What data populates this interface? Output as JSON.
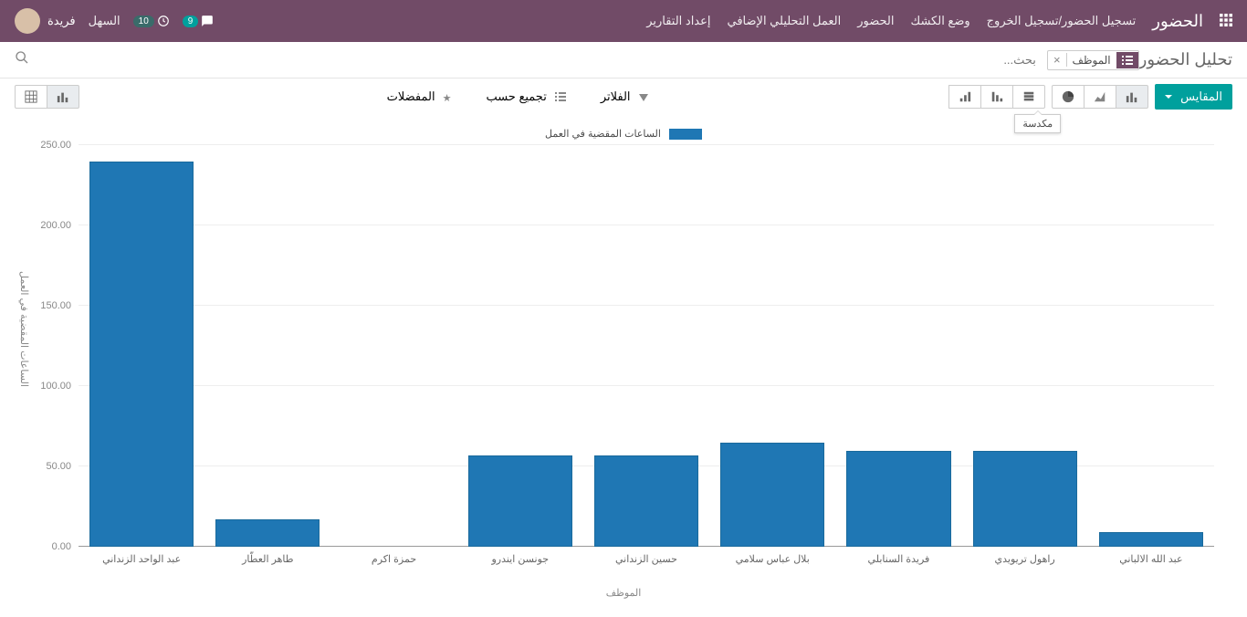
{
  "topbar": {
    "brand": "الحضور",
    "nav": [
      "تسجيل الحضور/تسجيل الخروج",
      "وضع الكشك",
      "الحضور",
      "العمل التحليلي الإضافي",
      "إعداد التقارير"
    ],
    "messages_badge": "9",
    "activities_badge": "10",
    "easy_label": "السهل",
    "user_name": "فريدة"
  },
  "control": {
    "page_title": "تحليل الحضور",
    "facet_label": "الموظف",
    "facet_remove": "×",
    "search_placeholder": "بحث..."
  },
  "toolbar": {
    "measures_label": "المقايس",
    "filters_label": "الفلاتر",
    "groupby_label": "تجميع حسب",
    "favorites_label": "المفضلات",
    "tooltip_stacked": "مكدسة"
  },
  "chart_data": {
    "type": "bar",
    "title": "",
    "legend_label": "الساعات المقضية في العمل",
    "xlabel": "الموظف",
    "ylabel": "الساعات المقضية في العمل",
    "ylim": [
      0,
      250
    ],
    "yticks": [
      0,
      50,
      100,
      150,
      200,
      250
    ],
    "ytick_labels": [
      "0.00",
      "50.00",
      "100.00",
      "150.00",
      "200.00",
      "250.00"
    ],
    "categories": [
      "عبد الواحد الزنداني",
      "طاهر العطّار",
      "حمزة اكرم",
      "جونسن ايندرو",
      "حسين الزنداني",
      "بلال عباس سلامي",
      "فريدة السنابلي",
      "راهول تريويدي",
      "عبد الله الالباني"
    ],
    "values": [
      240,
      17,
      0,
      57,
      57,
      65,
      60,
      60,
      9
    ]
  }
}
